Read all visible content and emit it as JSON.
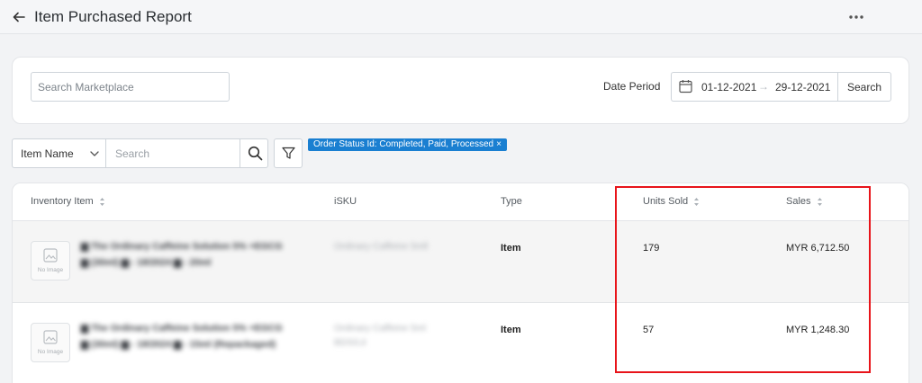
{
  "header": {
    "title": "Item Purchased Report",
    "back_icon": "arrow-left-icon",
    "more_icon": "more-horizontal-icon"
  },
  "filters": {
    "marketplace_placeholder": "Search Marketplace",
    "date_period_label": "Date Period",
    "date_from": "01-12-2021",
    "date_arrow": "→",
    "date_to": "29-12-2021",
    "search_button": "Search",
    "field_select": "Item Name",
    "search_placeholder": "Search",
    "status_tag": "Order Status Id: Completed, Paid, Processed",
    "status_tag_close": "×"
  },
  "table": {
    "columns": [
      "Inventory Item",
      "iSKU",
      "Type",
      "Units Sold",
      "Sales"
    ],
    "no_image_label": "No Image",
    "rows": [
      {
        "item_line1": "▆ The Ordinary Caffeine Solution 5% +EGCG",
        "item_line2": "▆ (30ml) ▆ - 18/2024 ▆ - 20ml",
        "isku": "Ordinary Caffeine 5mll",
        "isku_line2": "",
        "type": "Item",
        "units_sold": "179",
        "sales": "MYR 6,712.50"
      },
      {
        "item_line1": "▆ The Ordinary Caffeine Solution 5% +EGCG",
        "item_line2": "▆ (30ml) ▆ - 18/2024 ▆ - 15ml (Repackaged)",
        "isku": "Ordinary Caffeine 5ml",
        "isku_line2": "BDS/Lit",
        "type": "Item",
        "units_sold": "57",
        "sales": "MYR 1,248.30"
      }
    ]
  },
  "colors": {
    "accent": "#1a7fd1",
    "highlight": "#e8141a",
    "background": "#f2f3f5"
  }
}
